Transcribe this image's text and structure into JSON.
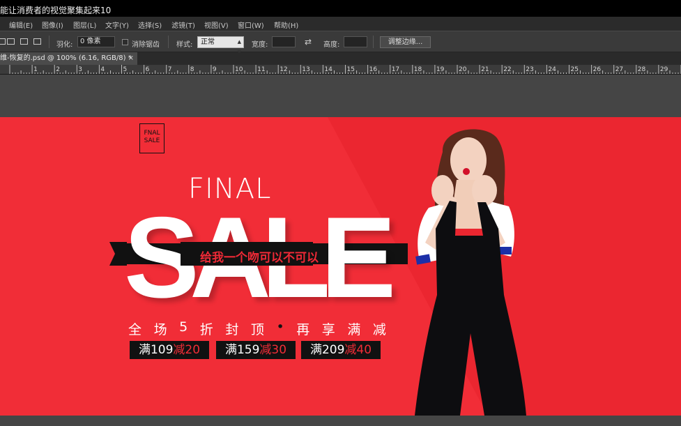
{
  "window": {
    "title": "能让消费者的视觉聚集起来10"
  },
  "menu": [
    "编辑(E)",
    "图像(I)",
    "图层(L)",
    "文字(Y)",
    "选择(S)",
    "滤镜(T)",
    "视图(V)",
    "窗口(W)",
    "帮助(H)"
  ],
  "options": {
    "feather_label": "羽化:",
    "feather_value": "0 像素",
    "antialias_label": "消除锯齿",
    "style_label": "样式:",
    "style_value": "正常",
    "width_label": "宽度:",
    "height_label": "高度:",
    "refine_button": "调整边缘..."
  },
  "document": {
    "tab_title": "维-恢复的.psd @ 100% (6.16, RGB/8) *",
    "close": "×"
  },
  "ruler": {
    "labels": [
      "1",
      "2",
      "3",
      "4",
      "5",
      "6",
      "7",
      "8",
      "9",
      "10",
      "11",
      "12",
      "13",
      "14",
      "15",
      "16",
      "17",
      "18",
      "19",
      "20",
      "21",
      "22",
      "23",
      "24",
      "25",
      "26",
      "27",
      "28",
      "29",
      "30"
    ]
  },
  "banner": {
    "logo": [
      "FNAL",
      "SALE"
    ],
    "final": "FINAL",
    "sale": "SALE",
    "ribbon_text": "给我一个吻可以不可以",
    "tagline": [
      "全",
      "场",
      "5",
      "折",
      "封",
      "顶",
      "•",
      "再",
      "享",
      "满",
      "减"
    ],
    "offers": [
      {
        "man": "满",
        "a": "109",
        "jian": "减",
        "b": "20"
      },
      {
        "man": "满",
        "a": "159",
        "jian": "减",
        "b": "30"
      },
      {
        "man": "满",
        "a": "209",
        "jian": "减",
        "b": "40"
      }
    ],
    "colors": {
      "bg": "#f12d37",
      "accent": "#f12d37",
      "ribbon": "#111111"
    }
  }
}
